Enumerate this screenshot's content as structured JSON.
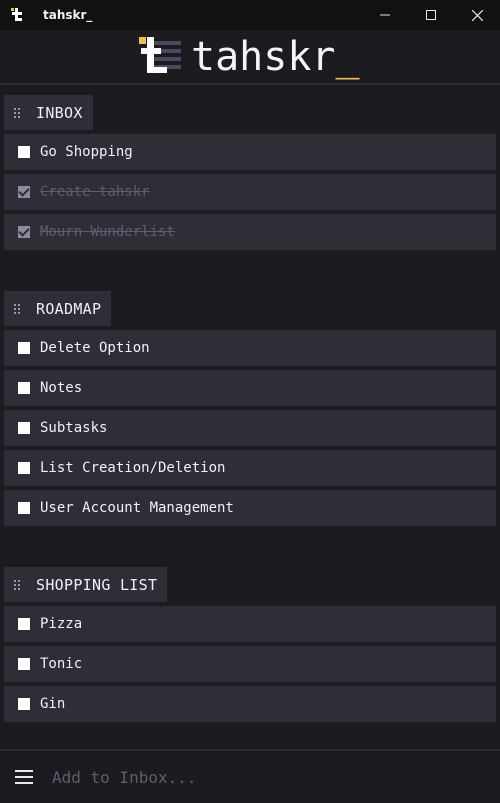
{
  "window": {
    "title": "tahskr_",
    "icon": "tahskr-logo-icon",
    "controls": [
      "minimize-icon",
      "maximize-icon",
      "close-icon"
    ]
  },
  "header": {
    "logo_text": "tahskr",
    "logo_cursor": "_",
    "accent_color": "#f0c04a"
  },
  "lists": [
    {
      "title": "INBOX",
      "tasks": [
        {
          "label": "Go Shopping",
          "done": false
        },
        {
          "label": "Create tahskr",
          "done": true
        },
        {
          "label": "Mourn Wunderlist",
          "done": true
        }
      ]
    },
    {
      "title": "ROADMAP",
      "tasks": [
        {
          "label": "Delete Option",
          "done": false
        },
        {
          "label": "Notes",
          "done": false
        },
        {
          "label": "Subtasks",
          "done": false
        },
        {
          "label": "List Creation/Deletion",
          "done": false
        },
        {
          "label": "User Account Management",
          "done": false
        }
      ]
    },
    {
      "title": "SHOPPING LIST",
      "tasks": [
        {
          "label": "Pizza",
          "done": false
        },
        {
          "label": "Tonic",
          "done": false
        },
        {
          "label": "Gin",
          "done": false
        }
      ]
    }
  ],
  "footer": {
    "menu_icon": "hamburger-menu-icon",
    "add_placeholder": "Add to Inbox..."
  }
}
